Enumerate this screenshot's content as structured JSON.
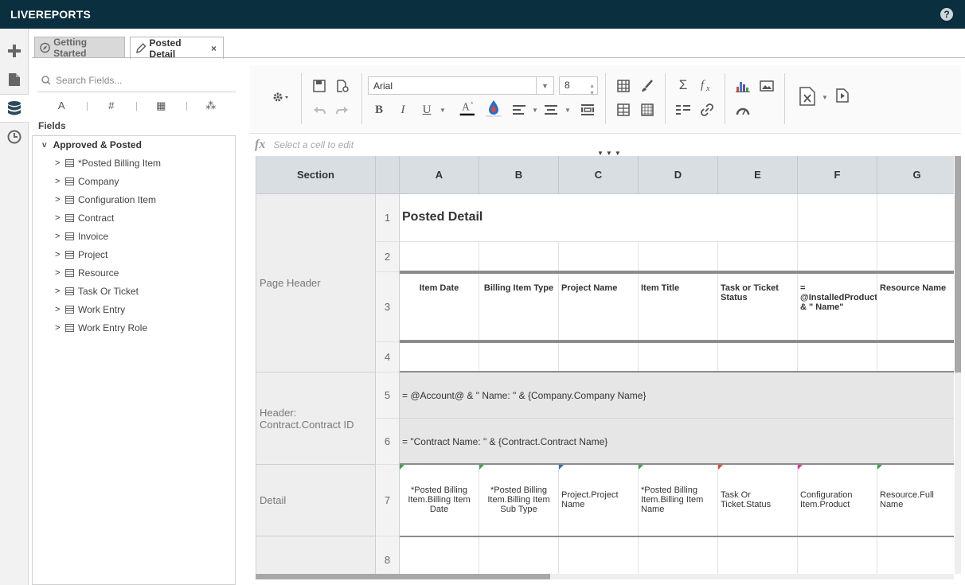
{
  "app": {
    "title": "LIVEREPORTS",
    "help_label": "?"
  },
  "tabs": [
    {
      "label": "Getting Started",
      "icon": "compass-icon"
    },
    {
      "label": "Posted Detail",
      "icon": "pencil-icon",
      "close": "×"
    }
  ],
  "fields_panel": {
    "search_placeholder": "Search Fields...",
    "filters": [
      "A",
      "#",
      "▦",
      "⁂"
    ],
    "heading": "Fields",
    "root": "Approved & Posted",
    "items": [
      "*Posted Billing Item",
      "Company",
      "Configuration Item",
      "Contract",
      "Invoice",
      "Project",
      "Resource",
      "Task Or Ticket",
      "Work Entry",
      "Work Entry Role"
    ]
  },
  "toolbar": {
    "font": "Arial",
    "font_size": "8",
    "bold": "B",
    "italic": "I",
    "underline": "U",
    "sigma": "Σ"
  },
  "formula_bar": {
    "placeholder": "Select a cell to edit",
    "fx": "fx"
  },
  "grid": {
    "section_header": "Section",
    "columns": [
      "A",
      "B",
      "C",
      "D",
      "E",
      "F",
      "G"
    ],
    "sections": [
      "Page Header",
      "Header: Contract.Contract ID",
      "Detail"
    ],
    "row_numbers": [
      "1",
      "2",
      "3",
      "4",
      "5",
      "6",
      "7",
      "8"
    ],
    "title": "Posted Detail",
    "header_row": [
      "Item Date",
      "Billing Item Type",
      "Project Name",
      "Item Title",
      "Task or Ticket Status",
      "= @InstalledProduct@ & \" Name\"",
      "Resource Name"
    ],
    "row5": "= @Account@ & \" Name: \" & {Company.Company Name}",
    "row6": "= \"Contract Name: \" & {Contract.Contract Name}",
    "detail_row": [
      "*Posted Billing Item.Billing Item Date",
      "*Posted Billing Item.Billing Item Sub Type",
      "Project.Project Name",
      "*Posted Billing Item.Billing Item Name",
      "Task Or Ticket.Status",
      "Configuration Item.Product",
      "Resource.Full Name"
    ],
    "detail_marker_colors": [
      "#3aa34a",
      "#3aa34a",
      "#2f6fb7",
      "#3aa34a",
      "#e04a2f",
      "#e0359b",
      "#3aa34a"
    ]
  }
}
